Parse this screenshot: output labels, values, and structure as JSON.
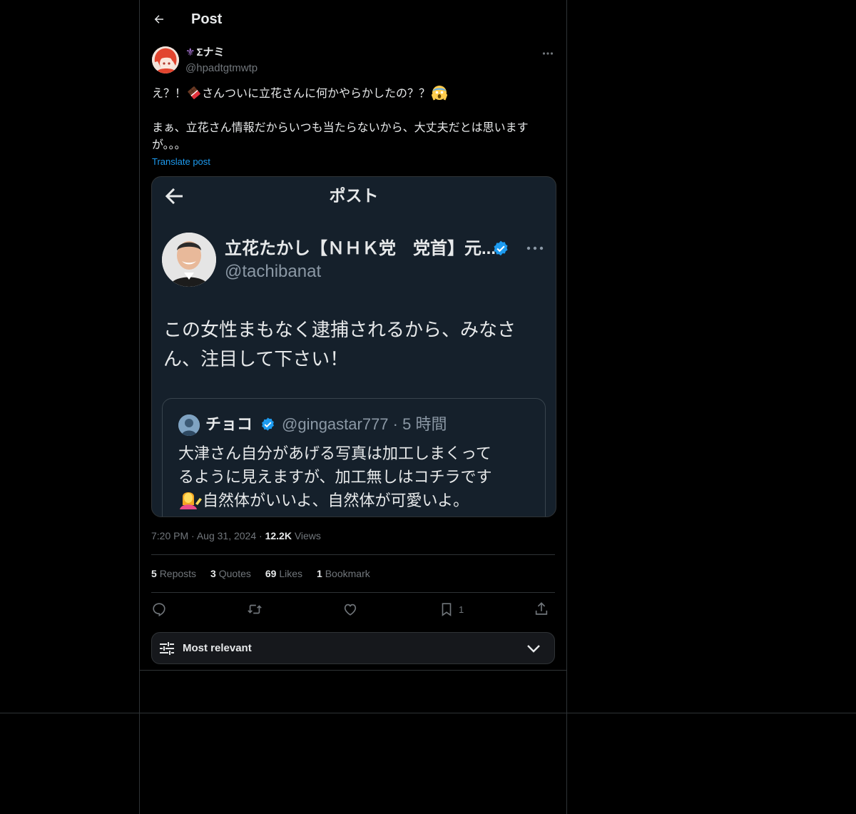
{
  "header": {
    "title": "Post"
  },
  "author": {
    "fleur": "⚜",
    "name": "Σナミ",
    "handle": "@hpadtgtmwtp"
  },
  "post": {
    "line1_a": "え？！",
    "line1_b": "さんついに立花さんに何かやらかしたの？？",
    "line2": "まぁ、立花さん情報だからいつも当たらないから、大丈夫だとは思います",
    "line3": "が。。。",
    "translate_label": "Translate post"
  },
  "embedded_screenshot": {
    "title": "ポスト",
    "name": "立花たかし【ＮＨＫ党　党首】元...",
    "handle": "@tachibanat",
    "text_line1": "この女性まもなく逮捕されるから、みなさ",
    "text_line2": "ん、注目して下さい！",
    "quote": {
      "name": "チョコ",
      "handle": "@gingastar777",
      "separator": "·",
      "time": "5 時間",
      "line1": "大津さん自分があげる写真は加工しまくって",
      "line2": "るように見えますが、加工無しはコチラです",
      "line3": "自然体がいいよ、自然体が可愛いよ。"
    }
  },
  "meta": {
    "time": "7:20 PM",
    "dot1": "·",
    "date": "Aug 31, 2024",
    "dot2": "·",
    "views_count": "12.2K",
    "views_label": "Views"
  },
  "stats": {
    "reposts_count": "5",
    "reposts_label": "Reposts",
    "quotes_count": "3",
    "quotes_label": "Quotes",
    "likes_count": "69",
    "likes_label": "Likes",
    "bookmarks_count": "1",
    "bookmarks_label": "Bookmark"
  },
  "actions": {
    "reply_icon": "reply-icon",
    "repost_icon": "repost-icon",
    "like_icon": "heart-icon",
    "bookmark_icon": "bookmark-icon",
    "bookmark_count": "1",
    "share_icon": "share-icon"
  },
  "sort": {
    "label": "Most relevant",
    "icon": "sliders-icon",
    "chevron": "chevron-down-icon"
  },
  "colors": {
    "background": "#000000",
    "text": "#e7e9ea",
    "muted": "#71767b",
    "link": "#1d9bf0",
    "border": "#2f3336",
    "embedded_bg": "#15202b",
    "verified": "#1d9bf0"
  }
}
